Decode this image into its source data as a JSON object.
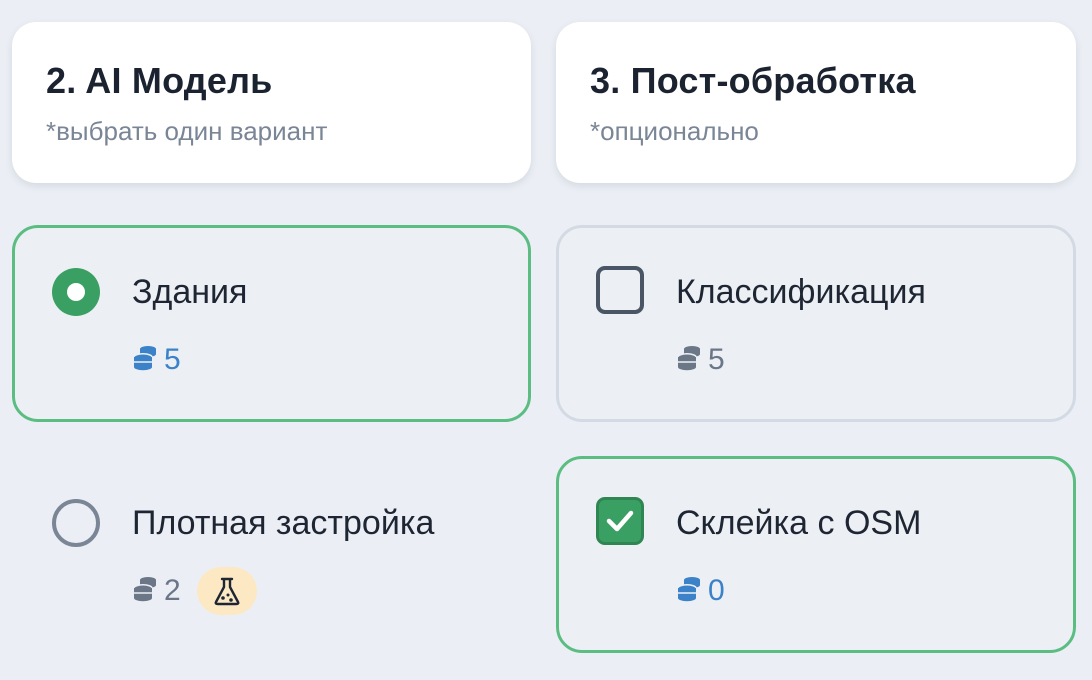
{
  "model_section": {
    "title": "2. AI Модель",
    "subtitle": "*выбрать один вариант",
    "options": [
      {
        "label": "Здания",
        "cost": "5",
        "selected": true
      },
      {
        "label": "Плотная застройка",
        "cost": "2",
        "selected": false,
        "badge": "flask-icon"
      }
    ]
  },
  "post_section": {
    "title": "3. Пост-обработка",
    "subtitle": "*опционально",
    "options": [
      {
        "label": "Классификация",
        "cost": "5",
        "checked": false
      },
      {
        "label": "Склейка с OSM",
        "cost": "0",
        "checked": true
      }
    ]
  },
  "colors": {
    "accent_green": "#3a9f63",
    "selected_border": "#5bbd82",
    "cost_blue": "#3b82c8",
    "experimental_badge": "#fde8c4"
  },
  "icons": {
    "cost": "coins-icon",
    "experimental": "flask-icon",
    "check": "checkmark-icon"
  }
}
